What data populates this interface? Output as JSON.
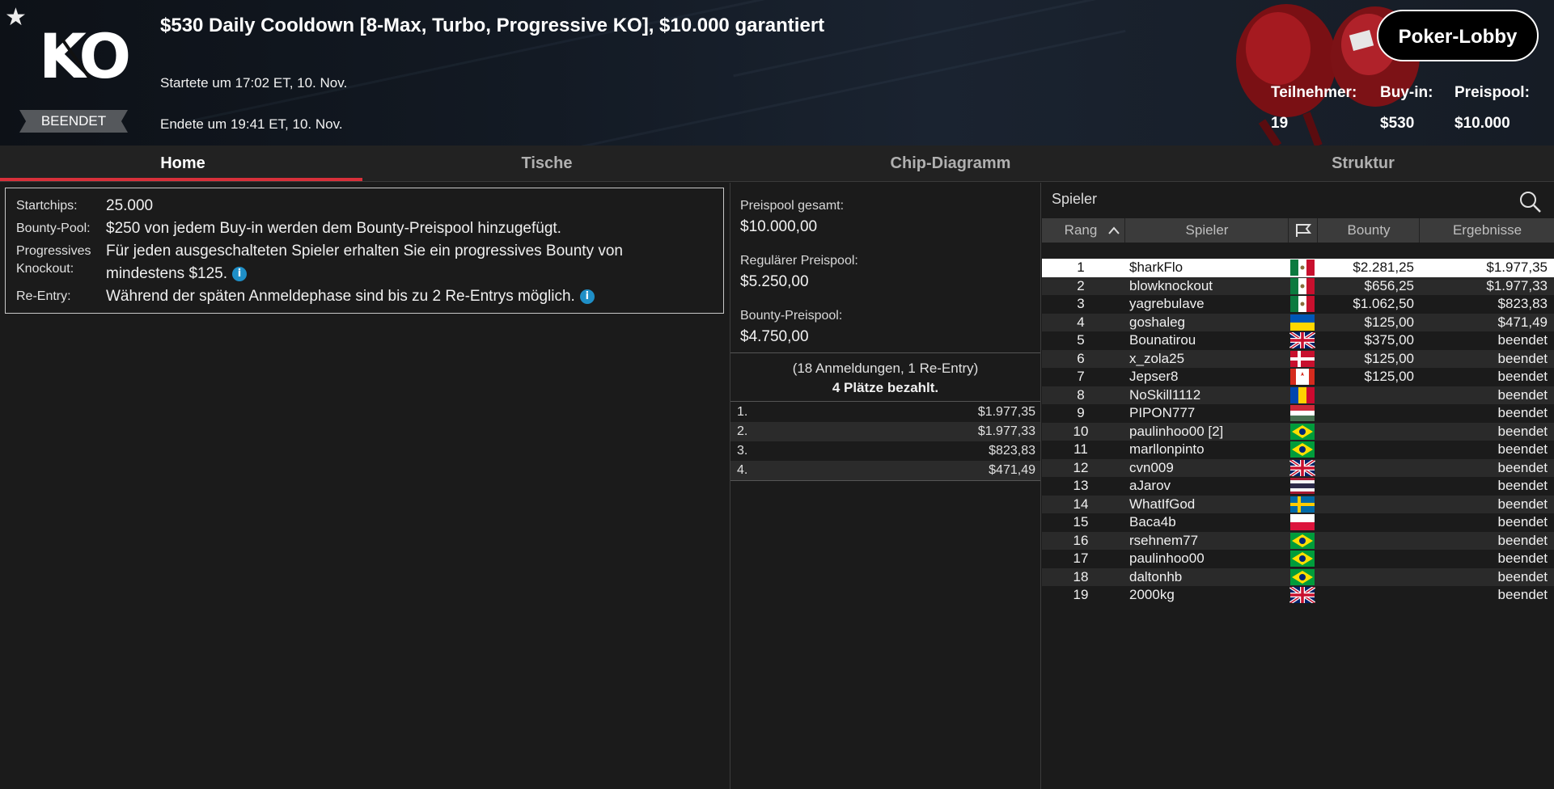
{
  "header": {
    "star_icon": "star-icon",
    "logo_text": "KO",
    "status_badge": "BEENDET",
    "title": "$530 Daily Cooldown [8-Max, Turbo, Progressive KO], $10.000 garantiert",
    "started": "Startete um 17:02 ET, 10. Nov.",
    "ended": "Endete um 19:41 ET, 10. Nov.",
    "lobby_button": "Poker-Lobby",
    "stats": {
      "participants_label": "Teilnehmer:",
      "participants_value": "19",
      "buyin_label": "Buy-in:",
      "buyin_value": "$530",
      "prizepool_label": "Preispool:",
      "prizepool_value": "$10.000"
    }
  },
  "tabs": [
    {
      "label": "Home",
      "active": true
    },
    {
      "label": "Tische",
      "active": false
    },
    {
      "label": "Chip-Diagramm",
      "active": false
    },
    {
      "label": "Struktur",
      "active": false
    }
  ],
  "info": {
    "startchips_label": "Startchips:",
    "startchips_value": "25.000",
    "bounty_label": "Bounty-Pool:",
    "bounty_value": "$250 von jedem Buy-in werden dem Bounty-Preispool hinzugefügt.",
    "pko_label_1": "Progressives",
    "pko_label_2": "Knockout:",
    "pko_value_1": "Für jeden ausgeschalteten Spieler erhalten Sie ein progressives Bounty von",
    "pko_value_2": "mindestens $125.",
    "reentry_label": "Re-Entry:",
    "reentry_value": "Während der späten Anmeldephase sind bis zu 2 Re-Entrys möglich."
  },
  "prizes": {
    "total_label": "Preispool gesamt:",
    "total_value": "$10.000,00",
    "regular_label": "Regulärer Preispool:",
    "regular_value": "$5.250,00",
    "bounty_label": "Bounty-Preispool:",
    "bounty_value": "$4.750,00",
    "entries": "(18 Anmeldungen, 1 Re-Entry)",
    "paid": "4 Plätze bezahlt.",
    "payouts": [
      {
        "pos": "1.",
        "amount": "$1.977,35"
      },
      {
        "pos": "2.",
        "amount": "$1.977,33"
      },
      {
        "pos": "3.",
        "amount": "$823,83"
      },
      {
        "pos": "4.",
        "amount": "$471,49"
      }
    ]
  },
  "players": {
    "search_label": "Spieler",
    "columns": {
      "rank": "Rang",
      "player": "Spieler",
      "bounty": "Bounty",
      "results": "Ergebnisse"
    },
    "rows": [
      {
        "rank": "1",
        "name": "$harkFlo",
        "flag": "mexico",
        "bounty": "$2.281,25",
        "result": "$1.977,35"
      },
      {
        "rank": "2",
        "name": "blowknockout",
        "flag": "mexico",
        "bounty": "$656,25",
        "result": "$1.977,33"
      },
      {
        "rank": "3",
        "name": "yagrebulave",
        "flag": "mexico",
        "bounty": "$1.062,50",
        "result": "$823,83"
      },
      {
        "rank": "4",
        "name": "goshaleg",
        "flag": "ukraine",
        "bounty": "$125,00",
        "result": "$471,49"
      },
      {
        "rank": "5",
        "name": "Bounatirou",
        "flag": "uk",
        "bounty": "$375,00",
        "result": "beendet"
      },
      {
        "rank": "6",
        "name": "x_zola25",
        "flag": "denmark",
        "bounty": "$125,00",
        "result": "beendet"
      },
      {
        "rank": "7",
        "name": "Jepser8",
        "flag": "canada",
        "bounty": "$125,00",
        "result": "beendet"
      },
      {
        "rank": "8",
        "name": "NoSkill1112",
        "flag": "moldova",
        "bounty": "",
        "result": "beendet"
      },
      {
        "rank": "9",
        "name": "PIPON777",
        "flag": "hungary",
        "bounty": "",
        "result": "beendet"
      },
      {
        "rank": "10",
        "name": "paulinhoo00 [2]",
        "flag": "brazil",
        "bounty": "",
        "result": "beendet"
      },
      {
        "rank": "11",
        "name": "marllonpinto",
        "flag": "brazil",
        "bounty": "",
        "result": "beendet"
      },
      {
        "rank": "12",
        "name": "cvn009",
        "flag": "uk",
        "bounty": "",
        "result": "beendet"
      },
      {
        "rank": "13",
        "name": "aJarov",
        "flag": "thailand",
        "bounty": "",
        "result": "beendet"
      },
      {
        "rank": "14",
        "name": "WhatIfGod",
        "flag": "sweden",
        "bounty": "",
        "result": "beendet"
      },
      {
        "rank": "15",
        "name": "Baca4b",
        "flag": "poland",
        "bounty": "",
        "result": "beendet"
      },
      {
        "rank": "16",
        "name": "rsehnem77",
        "flag": "brazil",
        "bounty": "",
        "result": "beendet"
      },
      {
        "rank": "17",
        "name": "paulinhoo00",
        "flag": "brazil",
        "bounty": "",
        "result": "beendet"
      },
      {
        "rank": "18",
        "name": "daltonhb",
        "flag": "brazil",
        "bounty": "",
        "result": "beendet"
      },
      {
        "rank": "19",
        "name": "2000kg",
        "flag": "uk",
        "bounty": "",
        "result": "beendet"
      }
    ]
  }
}
